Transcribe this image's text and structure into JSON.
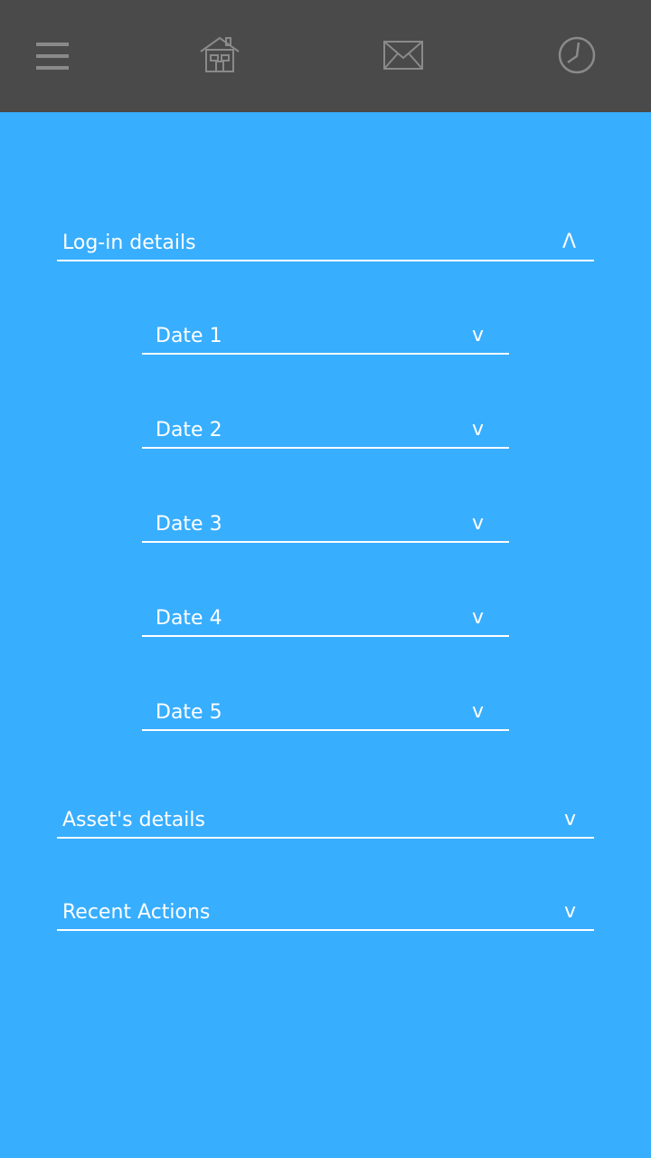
{
  "header": {
    "icons": [
      "menu-icon",
      "home-icon",
      "mail-icon",
      "clock-icon"
    ],
    "background": "#4a4a4a",
    "icon_color": "#8a8a8a"
  },
  "main": {
    "background": "#38aeff",
    "sections": [
      {
        "label": "Log-in details",
        "chevron": "Λ",
        "expanded": true,
        "items": [
          {
            "label": "Date 1",
            "chevron": "v"
          },
          {
            "label": "Date 2",
            "chevron": "v"
          },
          {
            "label": "Date 3",
            "chevron": "v"
          },
          {
            "label": "Date 4",
            "chevron": "v"
          },
          {
            "label": "Date 5",
            "chevron": "v"
          }
        ]
      },
      {
        "label": "Asset's details",
        "chevron": "v",
        "expanded": false
      },
      {
        "label": "Recent Actions",
        "chevron": "v",
        "expanded": false
      }
    ]
  }
}
